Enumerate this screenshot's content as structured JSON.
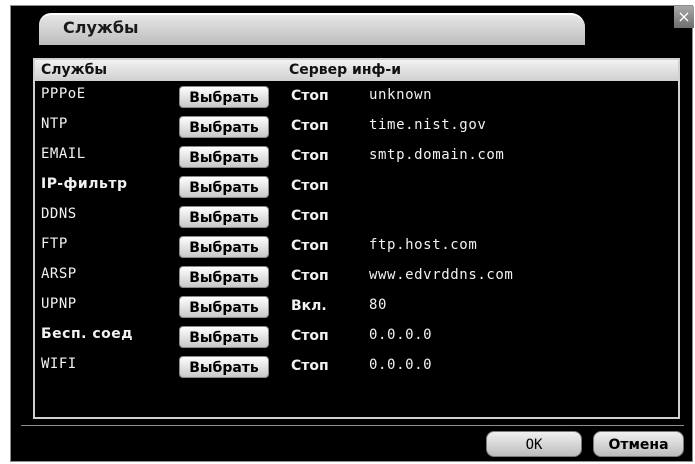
{
  "window": {
    "title": "Службы",
    "close_glyph": "×"
  },
  "table": {
    "header_services": "Службы",
    "header_server_info": "Сервер инф-и",
    "rows": [
      {
        "name": "PPPoE",
        "button": "Выбрать",
        "status": "Стоп",
        "info": "unknown"
      },
      {
        "name": "NTP",
        "button": "Выбрать",
        "status": "Стоп",
        "info": "time.nist.gov"
      },
      {
        "name": "EMAIL",
        "button": "Выбрать",
        "status": "Стоп",
        "info": "smtp.domain.com"
      },
      {
        "name": "IP-фильтр",
        "button": "Выбрать",
        "status": "Стоп",
        "info": ""
      },
      {
        "name": "DDNS",
        "button": "Выбрать",
        "status": "Стоп",
        "info": ""
      },
      {
        "name": "FTP",
        "button": "Выбрать",
        "status": "Стоп",
        "info": "ftp.host.com"
      },
      {
        "name": "ARSP",
        "button": "Выбрать",
        "status": "Стоп",
        "info": "www.edvrddns.com"
      },
      {
        "name": "UPNP",
        "button": "Выбрать",
        "status": "Вкл.",
        "info": "80"
      },
      {
        "name": "Бесп. соед",
        "button": "Выбрать",
        "status": "Стоп",
        "info": "0.0.0.0"
      },
      {
        "name": "WIFI",
        "button": "Выбрать",
        "status": "Стоп",
        "info": "0.0.0.0"
      }
    ]
  },
  "footer": {
    "ok_label": "OK",
    "cancel_label": "Отмена"
  }
}
